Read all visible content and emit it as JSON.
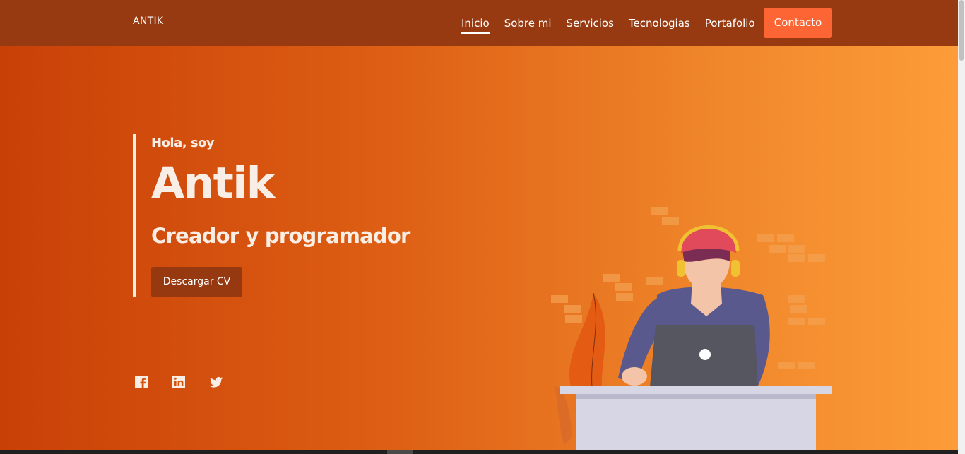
{
  "nav": {
    "brand": "ANTIK",
    "links": [
      "Inicio",
      "Sobre mi",
      "Servicios",
      "Tecnologias",
      "Portafolio"
    ],
    "active": "Inicio",
    "contact": "Contacto"
  },
  "hero": {
    "greeting": "Hola, soy",
    "name": "Antik",
    "role": "Creador y programador",
    "cta": "Descargar CV"
  },
  "social": [
    {
      "icon": "facebook-icon"
    },
    {
      "icon": "linkedin-icon"
    },
    {
      "icon": "twitter-icon"
    }
  ],
  "colors": {
    "navbar": "#983a11",
    "accent": "#fd6535",
    "cta": "#963810",
    "gradient_start": "#c94007",
    "gradient_end": "#fd9c38",
    "text_light": "#f8eee5"
  }
}
